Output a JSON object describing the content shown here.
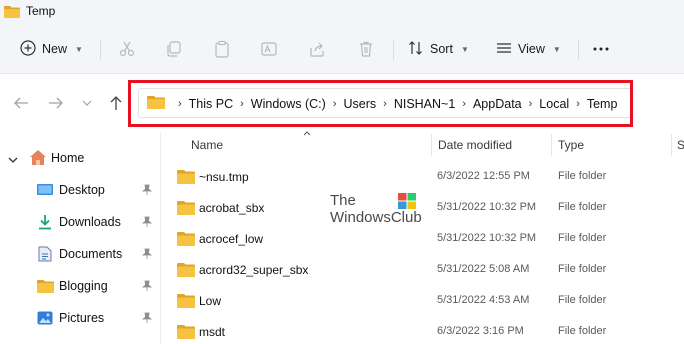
{
  "window": {
    "title": "Temp"
  },
  "toolbar": {
    "new_label": "New",
    "sort_label": "Sort",
    "view_label": "View",
    "icons": [
      "cut-icon",
      "copy-icon",
      "paste-icon",
      "rename-icon",
      "share-icon",
      "delete-icon"
    ]
  },
  "address": {
    "crumbs": [
      "This PC",
      "Windows (C:)",
      "Users",
      "NISHAN~1",
      "AppData",
      "Local",
      "Temp"
    ],
    "highlight_color": "#e81123"
  },
  "sidebar": {
    "items": [
      {
        "label": "Home",
        "icon": "home-icon",
        "pinned": false
      },
      {
        "label": "Desktop",
        "icon": "desktop-icon",
        "pinned": true
      },
      {
        "label": "Downloads",
        "icon": "download-icon",
        "pinned": true
      },
      {
        "label": "Documents",
        "icon": "documents-icon",
        "pinned": true
      },
      {
        "label": "Blogging",
        "icon": "folder-icon",
        "pinned": true
      },
      {
        "label": "Pictures",
        "icon": "pictures-icon",
        "pinned": true
      }
    ]
  },
  "columns": {
    "name": "Name",
    "date": "Date modified",
    "type": "Type",
    "size": "S"
  },
  "files": [
    {
      "name": "~nsu.tmp",
      "date": "6/3/2022 12:55 PM",
      "type": "File folder"
    },
    {
      "name": "acrobat_sbx",
      "date": "5/31/2022 10:32 PM",
      "type": "File folder"
    },
    {
      "name": "acrocef_low",
      "date": "5/31/2022 10:32 PM",
      "type": "File folder"
    },
    {
      "name": "acrord32_super_sbx",
      "date": "5/31/2022 5:08 AM",
      "type": "File folder"
    },
    {
      "name": "Low",
      "date": "5/31/2022 4:53 AM",
      "type": "File folder"
    },
    {
      "name": "msdt",
      "date": "6/3/2022 3:16 PM",
      "type": "File folder"
    }
  ],
  "watermark": {
    "line1": "The",
    "line2": "WindowsClub"
  },
  "colors": {
    "folder": "#f5c242",
    "folder_dark": "#e0a526",
    "accent": "#0067c0"
  }
}
